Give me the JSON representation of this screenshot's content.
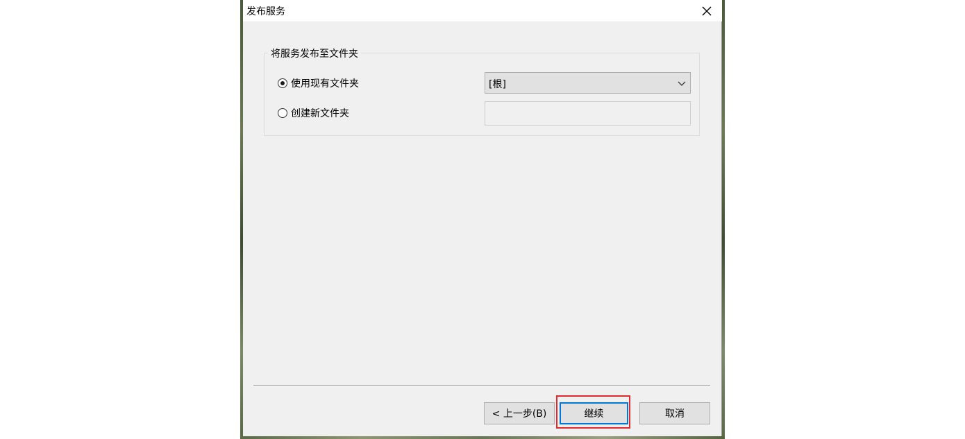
{
  "dialog": {
    "title": "发布服务",
    "close_icon": "close-icon"
  },
  "group": {
    "legend": "将服务发布至文件夹"
  },
  "options": {
    "use_existing": {
      "label": "使用现有文件夹",
      "selected": true
    },
    "create_new": {
      "label": "创建新文件夹",
      "selected": false
    }
  },
  "folder_select": {
    "value": "[根]",
    "arrow_icon": "chevron-down-icon"
  },
  "new_folder_input": {
    "value": "",
    "placeholder": ""
  },
  "buttons": {
    "back": "< 上一步(B)",
    "continue": "继续",
    "cancel": "取消"
  },
  "colors": {
    "highlight": "#e0282e",
    "focus": "#0078d7"
  }
}
